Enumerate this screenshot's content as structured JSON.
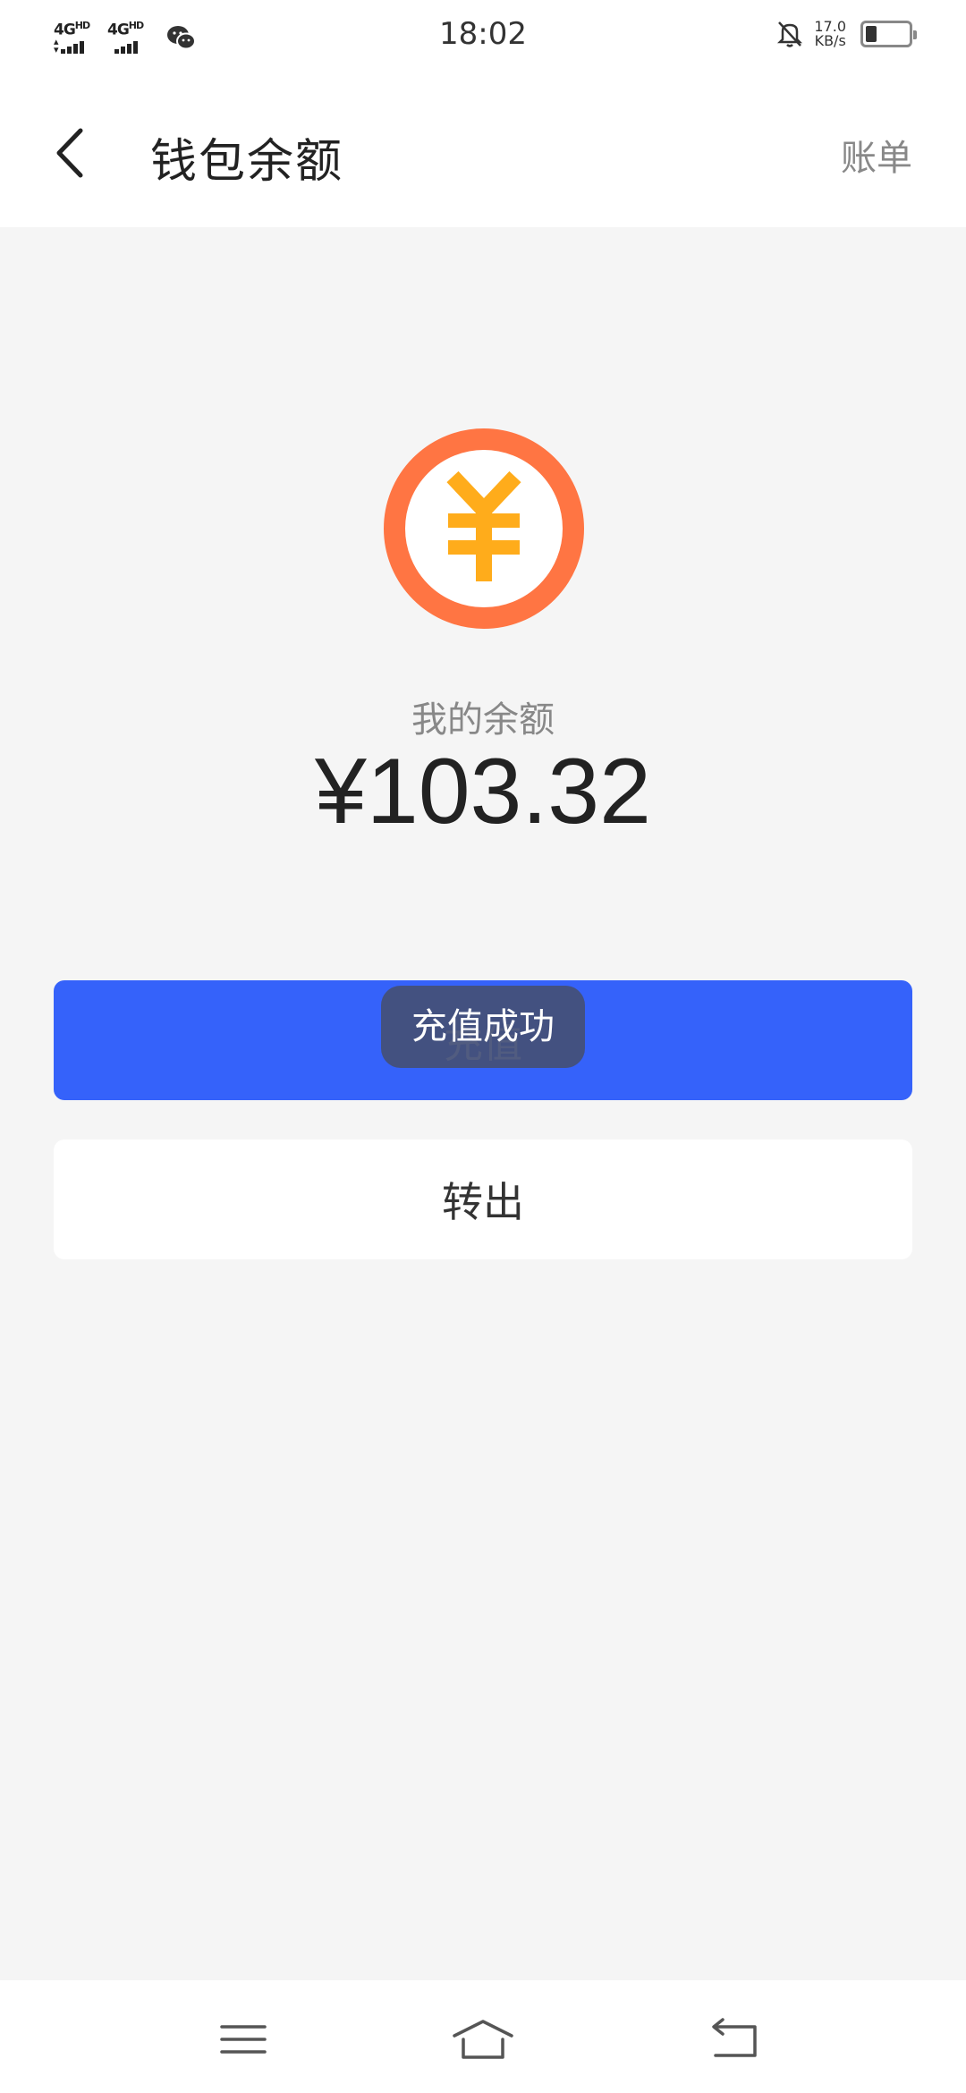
{
  "status_bar": {
    "network_1": "4G",
    "network_1_sup": "HD",
    "network_2": "4G",
    "network_2_sup": "HD",
    "time": "18:02",
    "speed_value": "17.0",
    "speed_unit": "KB/s",
    "battery_level": 0.25
  },
  "header": {
    "title": "钱包余额",
    "bill_label": "账单"
  },
  "balance": {
    "label": "我的余额",
    "amount": "¥103.32"
  },
  "actions": {
    "recharge_label": "充值",
    "transfer_label": "转出"
  },
  "toast": {
    "message": "充值成功"
  },
  "colors": {
    "primary": "#3562fa",
    "coin_ring": "#ff7543",
    "coin_symbol": "#ffac1b"
  },
  "icons": {
    "back": "chevron-left-icon",
    "coin": "yuan-coin-icon",
    "nav_menu": "menu-icon",
    "nav_home": "home-icon",
    "nav_back": "back-arrow-icon"
  }
}
